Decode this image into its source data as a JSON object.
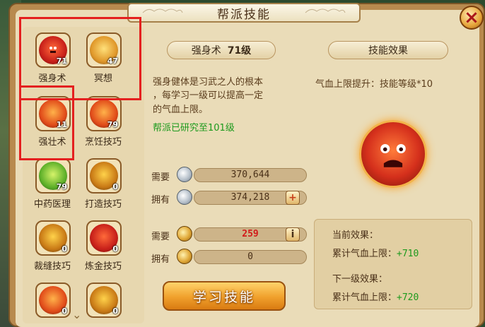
{
  "window": {
    "title": "帮派技能",
    "close_glyph": "×"
  },
  "skills": [
    {
      "name": "强身术",
      "level": "71",
      "icon": "red-rage-orb-icon"
    },
    {
      "name": "冥想",
      "level": "47",
      "icon": "gold-meditation-orb-icon"
    },
    {
      "name": "强壮术",
      "level": "11",
      "icon": "fire-strength-orb-icon"
    },
    {
      "name": "烹饪技巧",
      "level": "79",
      "icon": "cooking-orb-icon"
    },
    {
      "name": "中药医理",
      "level": "79",
      "icon": "herb-leaf-orb-icon"
    },
    {
      "name": "打造技巧",
      "level": "0",
      "icon": "forging-hammer-orb-icon"
    },
    {
      "name": "裁缝技巧",
      "level": "0",
      "icon": "tailoring-orb-icon"
    },
    {
      "name": "炼金技巧",
      "level": "0",
      "icon": "alchemy-orb-icon"
    },
    {
      "name": "",
      "level": "0",
      "icon": "talisman-orb-icon"
    },
    {
      "name": "",
      "level": "0",
      "icon": "gem-orb-icon"
    }
  ],
  "selected": {
    "name": "强身术",
    "level_text": "71级",
    "description": [
      "强身健体是习武之人的根本",
      "，每学习一级可以提高一定",
      "的气血上限。"
    ],
    "researched": "帮派已研究至101级"
  },
  "costs": {
    "need_label": "需要",
    "have_label": "拥有",
    "silver_need": "370,644",
    "silver_have": "374,218",
    "gold_need": "259",
    "gold_have": "0",
    "plus_glyph": "+",
    "info_glyph": "i"
  },
  "learn_button": "学习技能",
  "effect": {
    "header": "技能效果",
    "summary": "气血上限提升：技能等级*10",
    "current_label": "当前效果：",
    "current_text": "累计气血上限：",
    "current_value": "+710",
    "next_label": "下一级效果：",
    "next_text": "累计气血上限：",
    "next_value": "+720"
  },
  "colors": {
    "highlight": "#e4201f",
    "gold_cost": "#d21a1a",
    "green": "#1d9a1d"
  },
  "scroll_glyph": "⌄"
}
